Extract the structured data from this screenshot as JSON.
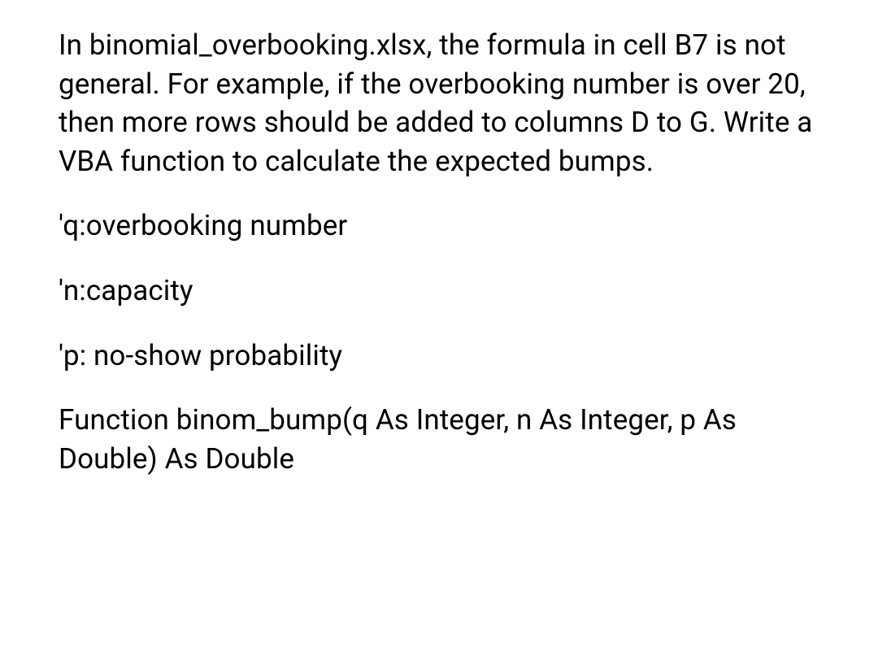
{
  "document": {
    "paragraphs": [
      "In binomial_overbooking.xlsx, the formula in cell B7 is not general. For example, if the overbooking number is over 20, then more rows should be added to columns D to G. Write a VBA function to calculate the expected bumps.",
      "'q:overbooking number",
      "'n:capacity",
      "'p: no-show probability",
      "Function binom_bump(q As Integer, n As Integer, p As Double) As Double"
    ]
  }
}
